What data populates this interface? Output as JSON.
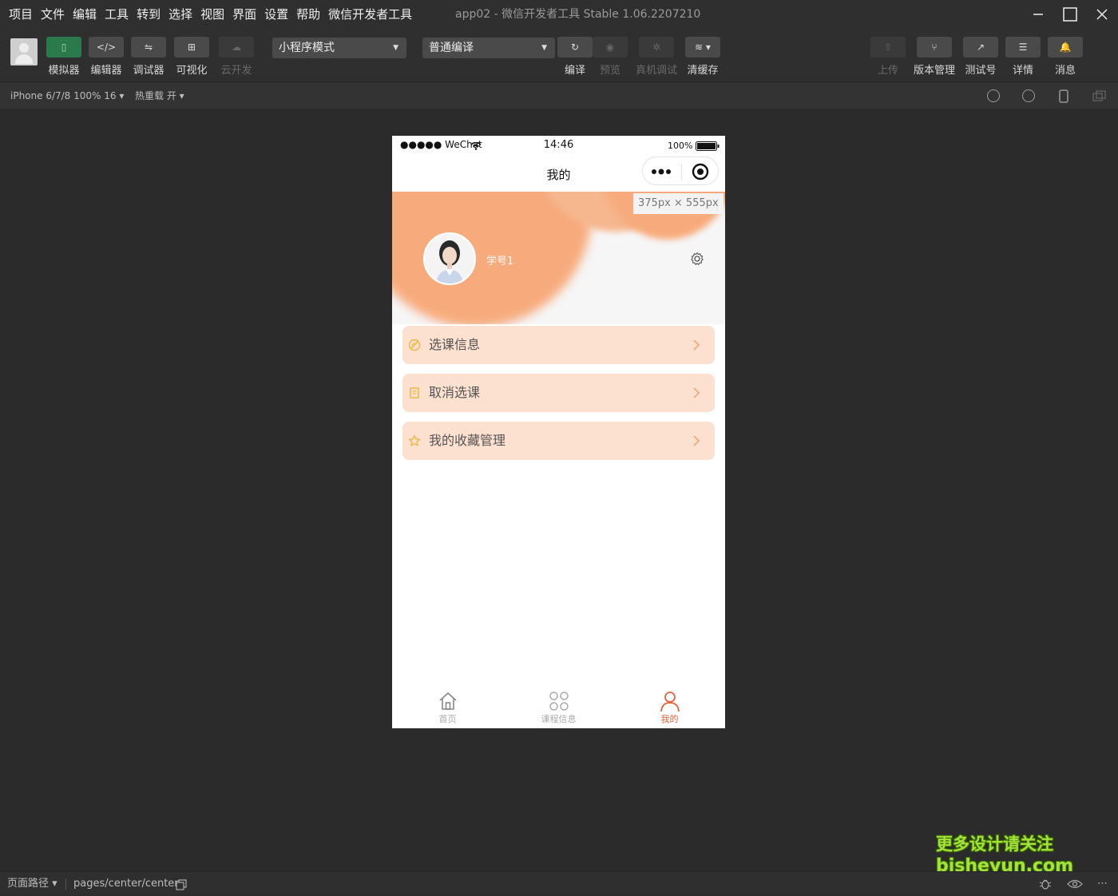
{
  "menu": [
    "项目",
    "文件",
    "编辑",
    "工具",
    "转到",
    "选择",
    "视图",
    "界面",
    "设置",
    "帮助",
    "微信开发者工具"
  ],
  "app_title": "app02 - 微信开发者工具 Stable 1.06.2207210",
  "toolbar": {
    "simulator": "模拟器",
    "editor": "编辑器",
    "debugger": "调试器",
    "visual": "可视化",
    "cloud": "云开发",
    "mode_select": "小程序模式",
    "compile_select": "普通编译",
    "compile": "编译",
    "preview": "预览",
    "remote_debug": "真机调试",
    "clear_cache": "清缓存",
    "upload": "上传",
    "version": "版本管理",
    "test_account": "测试号",
    "details": "详情",
    "messages": "消息"
  },
  "subbar": {
    "device": "iPhone 6/7/8 100% 16 ▾",
    "hot_reload": "热重载 开 ▾"
  },
  "phone": {
    "status_left": "●●●●● WeChat",
    "status_time": "14:46",
    "status_battery": "100%",
    "nav_title": "我的",
    "size_badge": "375px × 555px",
    "user_name": "学号1",
    "menu_items": [
      {
        "label": "选课信息",
        "icon": "edit-circle-icon"
      },
      {
        "label": "取消选课",
        "icon": "document-icon"
      },
      {
        "label": "我的收藏管理",
        "icon": "star-icon"
      }
    ],
    "tabs": [
      {
        "label": "首页",
        "icon": "home-icon",
        "active": false
      },
      {
        "label": "课程信息",
        "icon": "grid-icon",
        "active": false
      },
      {
        "label": "我的",
        "icon": "user-icon",
        "active": true
      }
    ]
  },
  "bottombar": {
    "page_path_label": "页面路径 ▾",
    "page_path": "pages/center/center"
  },
  "watermark": {
    "line1": "更多设计请关注",
    "line2": "bisheyun.com"
  },
  "colors": {
    "accent": "#e5623a",
    "peach": "#f7ab7c",
    "list_bg": "#fde1d0",
    "icon_yellow": "#f1b53a"
  }
}
